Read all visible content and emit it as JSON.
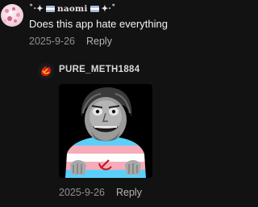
{
  "comment": {
    "username_prefix": "˚‧✦",
    "username": "naomi",
    "username_suffix": "✦‧˚",
    "text": "Does this app hate everything",
    "date": "2025-9-26",
    "reply_label": "Reply"
  },
  "reply": {
    "username": "PURE_METH1884",
    "date": "2025-9-26",
    "reply_label": "Reply",
    "image_icon": "meme-image"
  },
  "colors": {
    "background": "#121212",
    "trans_blue": "#5bcffa",
    "trans_pink": "#f5abb9",
    "trans_white": "#ffffff",
    "soviet_red": "#c8141e"
  }
}
